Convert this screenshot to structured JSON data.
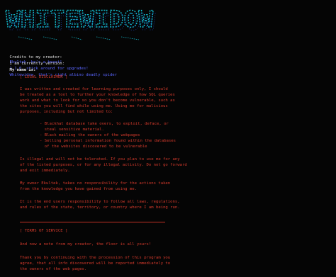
{
  "colors": {
    "background": "#050505",
    "banner_cyan": "#12b7c9",
    "banner_blue": "#1f4fd6",
    "info_text": "#e8e8e8",
    "info_value": "#5a66ff",
    "warning_red": "#d43a2c"
  },
  "banner": {
    "art_text": "WHITEWIDOW"
  },
  "info": {
    "credits_label": "Credits to my creator:",
    "credits_name": "Ekultek",
    "credits_rest": ", he's a beast!",
    "version_label": "I am currently version:",
    "version_value": "1.1.0",
    "version_rest": ", stick around for upgrades!",
    "name_label": "My name is:",
    "name_value": "Whitewidow",
    "name_rest": ", that's right albino deadly spider"
  },
  "disclaimer": {
    "header": "[ LEGAL DISCLAIMER ]",
    "para1": [
      "I was written and created for learning purposes only, I should",
      "be treated as a tool to further your knowledge of how SQL queries",
      "work and what to look for so you don't become vulnerable, such as",
      "the sites you will find while using me. Using me for malicious",
      "purposes, including but not limited to:"
    ],
    "bullets": [
      "- Blackhat database take overs, to exploit, deface, or",
      "  steal sensitive material.",
      "- Black mailing the owners of the webpages",
      "- Selling personal information found within the databases",
      "  of the websites discovered to be vulnerable"
    ],
    "para2": [
      "Is illegal and will not be tolerated. If you plan to use me for any",
      "of the listed purposes, or for any illegal activity. Do not go forward",
      "and exit immediately."
    ],
    "para3": [
      "My owner Ekultek, takes no responsibility for the actions taken",
      "from the knowledge you have gained from using me."
    ],
    "para4": [
      "It is the end users responsibility to follow all laws, regulations,",
      "and rules of the state, territory, or country where I am being run."
    ]
  },
  "terms": {
    "header": "[ TERMS OF SERVICE ]",
    "intro": "And now a note from my creator, the floor is all yours!",
    "para": [
      "Thank you by continuing with the procession of this program you",
      "agree, that all info discovered will be reported immediately to",
      "the owners of the web pages."
    ]
  }
}
